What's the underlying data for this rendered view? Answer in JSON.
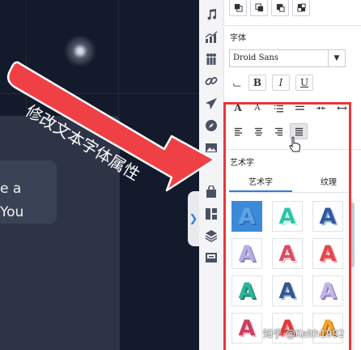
{
  "canvas": {
    "card_line1": "e a",
    "card_line2": "You"
  },
  "annotation": {
    "text": "修改文本字体属性",
    "color": "#e8373b"
  },
  "strip": {
    "icons": [
      "music-note-icon",
      "chart-icon",
      "people-icon",
      "link-icon",
      "airplane-icon",
      "compass-icon",
      "image-icon",
      "bag-icon",
      "layout-icon",
      "layers-icon",
      "inbox-icon"
    ]
  },
  "font": {
    "section_label": "字体",
    "selected_font": "Droid Sans",
    "bold_label": "B",
    "italic_label": "I",
    "underline_label": "U"
  },
  "art": {
    "section_label": "艺术字",
    "tabs": [
      {
        "label": "艺术字",
        "active": true
      },
      {
        "label": "纹理",
        "active": false
      }
    ],
    "tiles": [
      {
        "glyph": "A",
        "style": "blue-shadow-on-blue",
        "selected": true
      },
      {
        "glyph": "A",
        "style": "teal-outline"
      },
      {
        "glyph": "A",
        "style": "navy-shadow"
      },
      {
        "glyph": "A",
        "style": "lavender"
      },
      {
        "glyph": "A",
        "style": "red-outline"
      },
      {
        "glyph": "A",
        "style": "red-shadow"
      },
      {
        "glyph": "A",
        "style": "teal-shadow"
      },
      {
        "glyph": "A",
        "style": "navy-shadow"
      },
      {
        "glyph": "A",
        "style": "lavender-shadow"
      },
      {
        "glyph": "A",
        "style": "crimson-shadow"
      },
      {
        "glyph": "A",
        "style": "red-shadow"
      },
      {
        "glyph": "A",
        "style": "orange-gradient"
      }
    ]
  },
  "watermark": "知乎 @Keith1992",
  "colors": {
    "accent": "#2f7fd8",
    "highlight": "#e8373b"
  }
}
